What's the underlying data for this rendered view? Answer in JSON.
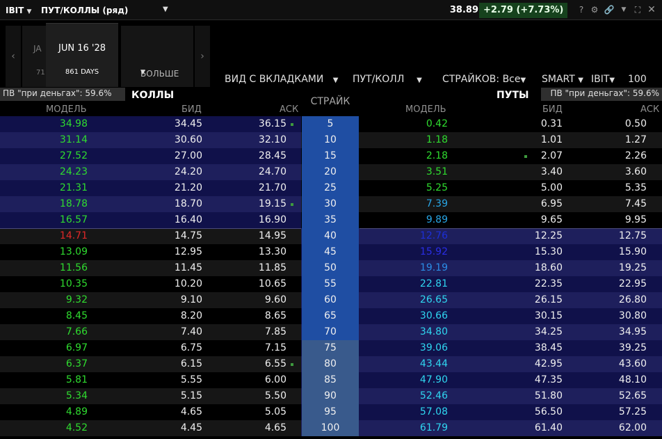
{
  "window": {
    "symbol": "IBIT",
    "title": "ПУТ/КОЛЛЫ (ряд)",
    "last_price": "38.89",
    "change": "+2.79 (+7.73%)"
  },
  "expirations": {
    "partial_label": "JA",
    "partial_days": "71",
    "active_date": "JUN 16 '28",
    "active_days": "861 DAYS",
    "more_label": "БОЛЬШЕ"
  },
  "controls": {
    "view": "ВИД С ВКЛАДКАМИ",
    "mode": "ПУТ/КОЛЛ",
    "strikes_label": "СТРАЙКОВ:",
    "strikes_value": "Все",
    "exchange": "SMART",
    "underlying": "IBIT",
    "quantity": "100"
  },
  "calls_header": {
    "iv_label": "ПВ \"при деньгах\": 59.6%",
    "title": "КОЛЛЫ"
  },
  "puts_header": {
    "iv_label": "ПВ \"при деньгах\": 59.6%",
    "title": "ПУТЫ"
  },
  "columns": {
    "model": "МОДЕЛЬ",
    "bid": "БИД",
    "ask": "АСК",
    "strike": "СТРАЙК",
    "put_model": "МОДЕЛЬ",
    "put_bid": "БИД",
    "put_ask": "АСК"
  },
  "colors": {
    "itm_call_row_a": "#10114a",
    "itm_call_row_b": "#1e1f5c",
    "otm_row_a": "#000000",
    "otm_row_b": "#161616",
    "strike_itm": "#1f4ea3",
    "strike_otm": "#395a8c",
    "model_green": "#2fdc2f",
    "model_red": "#e02828",
    "model_blue": "#1e90ff"
  },
  "rows": [
    {
      "strike": "5",
      "c_model": "34.98",
      "c_bid": "34.45",
      "c_ask": "36.15",
      "p_model": "0.42",
      "p_bid": "0.31",
      "p_ask": "0.50"
    },
    {
      "strike": "10",
      "c_model": "31.14",
      "c_bid": "30.60",
      "c_ask": "32.10",
      "p_model": "1.18",
      "p_bid": "1.01",
      "p_ask": "1.27"
    },
    {
      "strike": "15",
      "c_model": "27.52",
      "c_bid": "27.00",
      "c_ask": "28.45",
      "p_model": "2.18",
      "p_bid": "2.07",
      "p_ask": "2.26"
    },
    {
      "strike": "20",
      "c_model": "24.23",
      "c_bid": "24.20",
      "c_ask": "24.70",
      "p_model": "3.51",
      "p_bid": "3.40",
      "p_ask": "3.60"
    },
    {
      "strike": "25",
      "c_model": "21.31",
      "c_bid": "21.20",
      "c_ask": "21.70",
      "p_model": "5.25",
      "p_bid": "5.00",
      "p_ask": "5.35"
    },
    {
      "strike": "30",
      "c_model": "18.78",
      "c_bid": "18.70",
      "c_ask": "19.15",
      "p_model": "7.39",
      "p_bid": "6.95",
      "p_ask": "7.45"
    },
    {
      "strike": "35",
      "c_model": "16.57",
      "c_bid": "16.40",
      "c_ask": "16.90",
      "p_model": "9.89",
      "p_bid": "9.65",
      "p_ask": "9.95"
    },
    {
      "strike": "40",
      "c_model": "14.71",
      "c_bid": "14.75",
      "c_ask": "14.95",
      "p_model": "12.76",
      "p_bid": "12.25",
      "p_ask": "12.75"
    },
    {
      "strike": "45",
      "c_model": "13.09",
      "c_bid": "12.95",
      "c_ask": "13.30",
      "p_model": "15.92",
      "p_bid": "15.30",
      "p_ask": "15.90"
    },
    {
      "strike": "50",
      "c_model": "11.56",
      "c_bid": "11.45",
      "c_ask": "11.85",
      "p_model": "19.19",
      "p_bid": "18.60",
      "p_ask": "19.25"
    },
    {
      "strike": "55",
      "c_model": "10.35",
      "c_bid": "10.20",
      "c_ask": "10.65",
      "p_model": "22.81",
      "p_bid": "22.35",
      "p_ask": "22.95"
    },
    {
      "strike": "60",
      "c_model": "9.32",
      "c_bid": "9.10",
      "c_ask": "9.60",
      "p_model": "26.65",
      "p_bid": "26.15",
      "p_ask": "26.80"
    },
    {
      "strike": "65",
      "c_model": "8.45",
      "c_bid": "8.20",
      "c_ask": "8.65",
      "p_model": "30.66",
      "p_bid": "30.15",
      "p_ask": "30.80"
    },
    {
      "strike": "70",
      "c_model": "7.66",
      "c_bid": "7.40",
      "c_ask": "7.85",
      "p_model": "34.80",
      "p_bid": "34.25",
      "p_ask": "34.95"
    },
    {
      "strike": "75",
      "c_model": "6.97",
      "c_bid": "6.75",
      "c_ask": "7.15",
      "p_model": "39.06",
      "p_bid": "38.45",
      "p_ask": "39.25"
    },
    {
      "strike": "80",
      "c_model": "6.37",
      "c_bid": "6.15",
      "c_ask": "6.55",
      "p_model": "43.44",
      "p_bid": "42.95",
      "p_ask": "43.60"
    },
    {
      "strike": "85",
      "c_model": "5.81",
      "c_bid": "5.55",
      "c_ask": "6.00",
      "p_model": "47.90",
      "p_bid": "47.35",
      "p_ask": "48.10"
    },
    {
      "strike": "90",
      "c_model": "5.34",
      "c_bid": "5.15",
      "c_ask": "5.50",
      "p_model": "52.46",
      "p_bid": "51.80",
      "p_ask": "52.65"
    },
    {
      "strike": "95",
      "c_model": "4.89",
      "c_bid": "4.65",
      "c_ask": "5.05",
      "p_model": "57.08",
      "p_bid": "56.50",
      "p_ask": "57.25"
    },
    {
      "strike": "100",
      "c_model": "4.52",
      "c_bid": "4.45",
      "c_ask": "4.65",
      "p_model": "61.79",
      "p_bid": "61.40",
      "p_ask": "62.00"
    }
  ]
}
